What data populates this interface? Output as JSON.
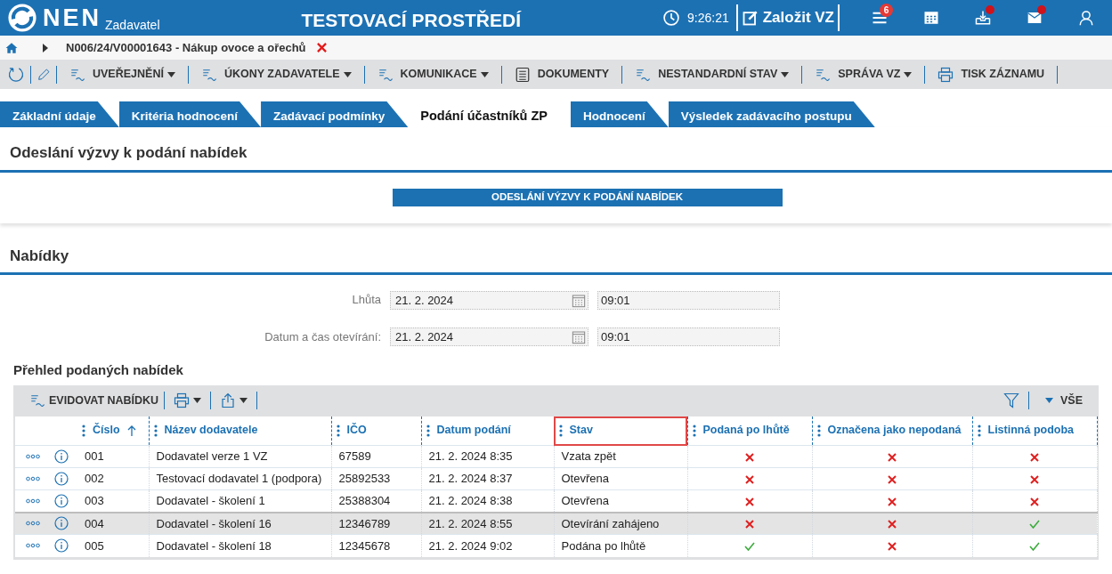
{
  "header": {
    "logo": "NEN",
    "role": "Zadavatel",
    "environment": "TESTOVACÍ PROSTŘEDÍ",
    "time": "9:26:21",
    "create_button": "Založit VZ",
    "menu_badge": "6",
    "inbox_unread": true,
    "mail_unread": true
  },
  "breadcrumb": {
    "text": "N006/24/V00001643 - Nákup ovoce a ořechů"
  },
  "toolbar": {
    "items": [
      {
        "kind": "menu",
        "label": "UVEŘEJNĚNÍ",
        "dropdown": true
      },
      {
        "kind": "menu",
        "label": "ÚKONY ZADAVATELE",
        "dropdown": true
      },
      {
        "kind": "menu",
        "label": "KOMUNIKACE",
        "dropdown": true
      },
      {
        "kind": "document",
        "label": "DOKUMENTY",
        "dropdown": false
      },
      {
        "kind": "menu",
        "label": "NESTANDARDNÍ STAV",
        "dropdown": true
      },
      {
        "kind": "menu",
        "label": "SPRÁVA VZ",
        "dropdown": true
      },
      {
        "kind": "print",
        "label": "TISK ZÁZNAMU",
        "dropdown": false
      }
    ]
  },
  "tabs": [
    {
      "label": "Základní údaje",
      "selected": false
    },
    {
      "label": "Kritéria hodnocení",
      "selected": false
    },
    {
      "label": "Zadávací podmínky",
      "selected": false
    },
    {
      "label": "Podání účastníků ZP",
      "selected": true
    },
    {
      "label": "Hodnocení",
      "selected": false
    },
    {
      "label": "Výsledek zadávacího postupu",
      "selected": false
    }
  ],
  "invitation": {
    "title": "Odeslání výzvy k podání nabídek",
    "button": "ODESLÁNÍ VÝZVY K PODÁNÍ NABÍDEK"
  },
  "offers": {
    "title": "Nabídky",
    "fields": [
      {
        "label": "Lhůta",
        "date": "21. 2. 2024",
        "time": "09:01"
      },
      {
        "label": "Datum a čas otevírání:",
        "date": "21. 2. 2024",
        "time": "09:01"
      }
    ]
  },
  "table": {
    "title": "Přehled podaných nabídek",
    "add_button": "EVIDOVAT NABÍDKU",
    "filter_label": "VŠE",
    "columns": [
      {
        "label": "Číslo",
        "sorted": true,
        "selected": false
      },
      {
        "label": "Název dodavatele",
        "sorted": false,
        "selected": false
      },
      {
        "label": "IČO",
        "sorted": false,
        "selected": false
      },
      {
        "label": "Datum podání",
        "sorted": false,
        "selected": false
      },
      {
        "label": "Stav",
        "sorted": false,
        "selected": true
      },
      {
        "label": "Podaná po lhůtě",
        "sorted": false,
        "selected": false
      },
      {
        "label": "Označena jako nepodaná",
        "sorted": false,
        "selected": false
      },
      {
        "label": "Listinná podoba",
        "sorted": false,
        "selected": false
      }
    ],
    "rows": [
      {
        "number": "001",
        "supplier": "Dodavatel verze 1 VZ",
        "ico": "67589",
        "submitted": "21. 2. 2024 8:35",
        "status": "Vzata zpět",
        "late": false,
        "marked_not_submitted": false,
        "paper": false,
        "selected": false
      },
      {
        "number": "002",
        "supplier": "Testovací dodavatel 1 (podpora)",
        "ico": "25892533",
        "submitted": "21. 2. 2024 8:37",
        "status": "Otevřena",
        "late": false,
        "marked_not_submitted": false,
        "paper": false,
        "selected": false
      },
      {
        "number": "003",
        "supplier": "Dodavatel - školení 1",
        "ico": "25388304",
        "submitted": "21. 2. 2024 8:38",
        "status": "Otevřena",
        "late": false,
        "marked_not_submitted": false,
        "paper": false,
        "selected": false
      },
      {
        "number": "004",
        "supplier": "Dodavatel - školení 16",
        "ico": "12346789",
        "submitted": "21. 2. 2024 8:55",
        "status": "Otevírání zahájeno",
        "late": false,
        "marked_not_submitted": false,
        "paper": true,
        "selected": true
      },
      {
        "number": "005",
        "supplier": "Dodavatel - školení 18",
        "ico": "12345678",
        "submitted": "21. 2. 2024 9:02",
        "status": "Podána po lhůtě",
        "late": true,
        "marked_not_submitted": false,
        "paper": true,
        "selected": false
      }
    ]
  }
}
